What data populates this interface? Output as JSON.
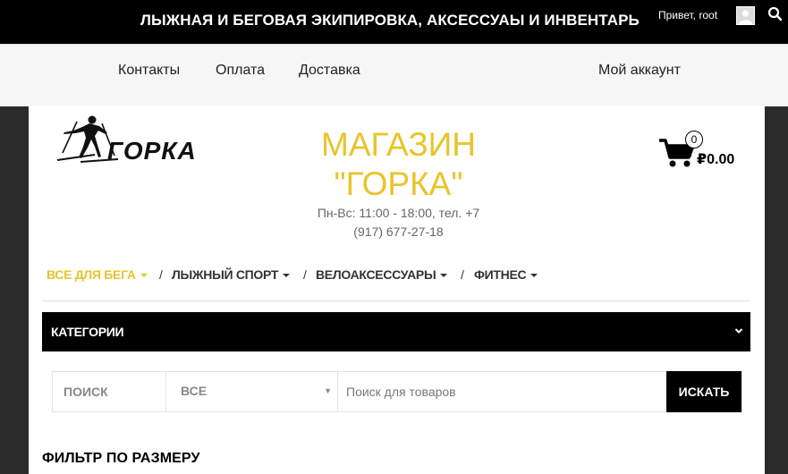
{
  "topbar": {
    "title": "ЛЫЖНАЯ И БЕГОВАЯ ЭКИПИРОВКА, АКСЕССУАЫ И ИНВЕНТАРЬ",
    "greeting": "Привет, root"
  },
  "nav": {
    "contacts": "Контакты",
    "payment": "Оплата",
    "delivery": "Доставка",
    "account": "Мой аккаунт"
  },
  "logo": {
    "text": "ГОРКА"
  },
  "shop": {
    "title_line1": "МАГАЗИН",
    "title_line2": "\"ГОРКА\"",
    "hours_line1": "Пн-Вс: 11:00 - 18:00, тел. +7",
    "hours_line2": "(917) 677-27-18"
  },
  "cart": {
    "count": "0",
    "total": "₽0.00"
  },
  "menu": {
    "items": [
      {
        "label": "ВСЕ ДЛЯ БЕГА"
      },
      {
        "label": "ЛЫЖНЫЙ СПОРТ"
      },
      {
        "label": "ВЕЛОАКСЕССУАРЫ"
      },
      {
        "label": "ФИТНЕС"
      }
    ],
    "separator": "/"
  },
  "categories": {
    "label": "КАТЕГОРИИ"
  },
  "search": {
    "label": "ПОИСК",
    "select_value": "ВСЕ",
    "placeholder": "Поиск для товаров",
    "button": "ИСКАТЬ"
  },
  "filter": {
    "title": "ФИЛЬТР ПО РАЗМЕРУ"
  },
  "colors": {
    "accent": "#e8c42a",
    "dark": "#000000",
    "sidebar": "#2b2b2b"
  },
  "icons": [
    "search-icon",
    "avatar-icon",
    "cart-icon",
    "chevron-down-icon",
    "caret-down-icon",
    "skier-logo-icon"
  ]
}
